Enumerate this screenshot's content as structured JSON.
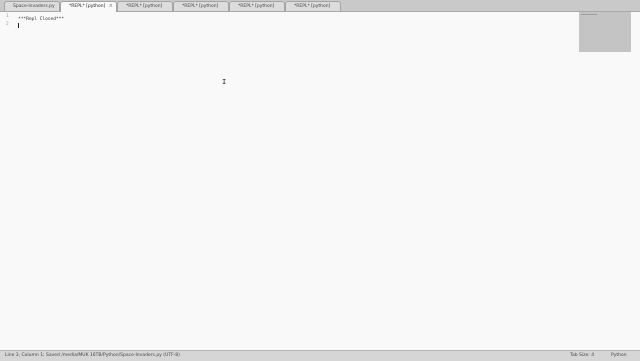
{
  "tabs": [
    {
      "label": "Space-Invaders.py",
      "active": false
    },
    {
      "label": "*REPL* [python]",
      "active": true
    },
    {
      "label": "*REPL* [python]",
      "active": false
    },
    {
      "label": "*REPL* [python]",
      "active": false
    },
    {
      "label": "*REPL* [python]",
      "active": false
    },
    {
      "label": "*REPL* [python]",
      "active": false
    }
  ],
  "close_glyph": "×",
  "editor": {
    "lines": [
      {
        "number": "1",
        "text": "***Repl Closed***"
      },
      {
        "number": "2",
        "text": ""
      }
    ]
  },
  "statusbar": {
    "left": "Line 3, Column 1; Saved /media/MUK 16TB/Python/Space-Invaders.py (UTF-8)",
    "tab_size": "Tab Size: 4",
    "syntax": "Python"
  },
  "cursor_glyph": "I"
}
